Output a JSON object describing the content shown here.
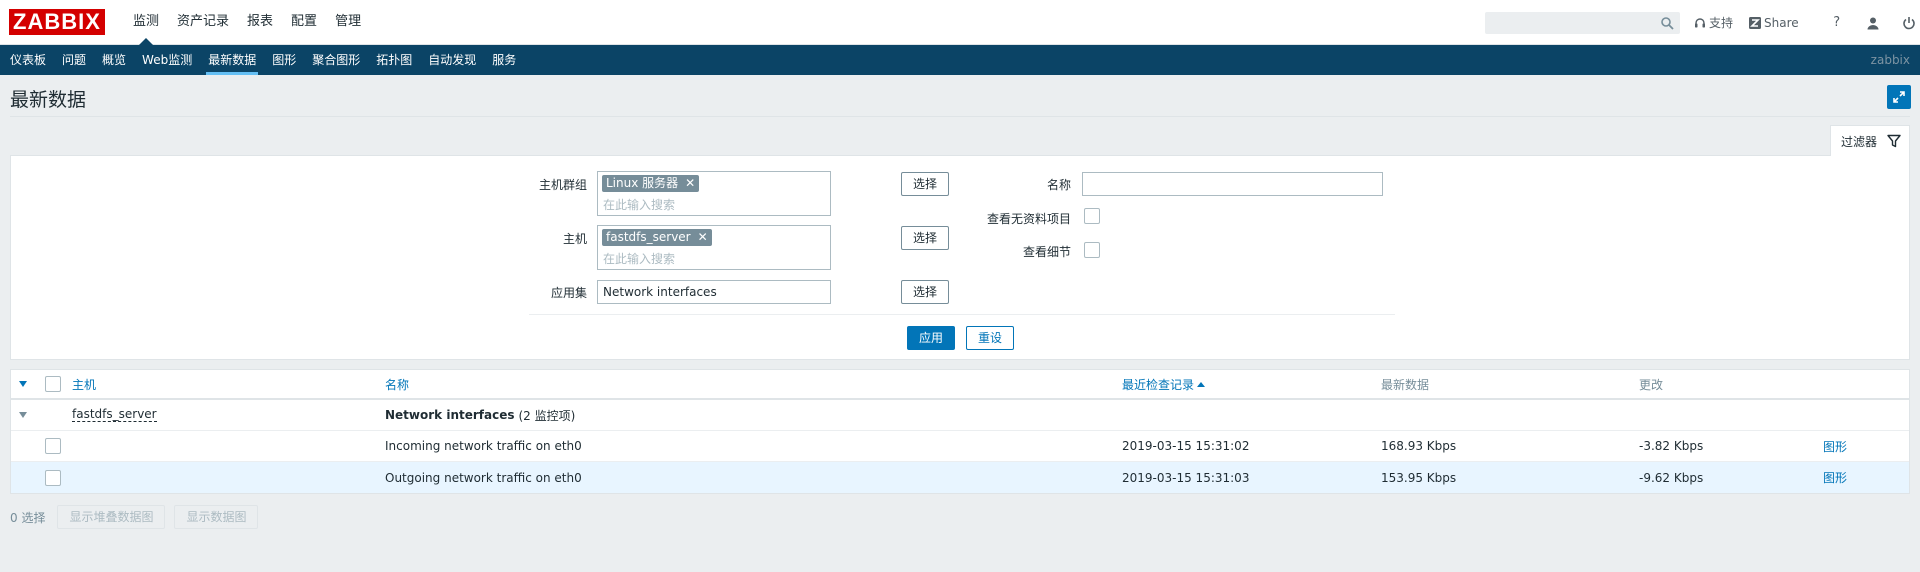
{
  "brand": {
    "logo_text": "ZABBIX",
    "logo_color": "#d40000"
  },
  "main_nav": [
    {
      "label": "监测",
      "active": true
    },
    {
      "label": "资产记录",
      "active": false
    },
    {
      "label": "报表",
      "active": false
    },
    {
      "label": "配置",
      "active": false
    },
    {
      "label": "管理",
      "active": false
    }
  ],
  "top_right": {
    "search_value": "",
    "support_label": "支持",
    "share_label": "Share",
    "help_label": "?"
  },
  "sub_nav": [
    {
      "label": "仪表板",
      "active": false
    },
    {
      "label": "问题",
      "active": false
    },
    {
      "label": "概览",
      "active": false
    },
    {
      "label": "Web监测",
      "active": false
    },
    {
      "label": "最新数据",
      "active": true
    },
    {
      "label": "图形",
      "active": false
    },
    {
      "label": "聚合图形",
      "active": false
    },
    {
      "label": "拓扑图",
      "active": false
    },
    {
      "label": "自动发现",
      "active": false
    },
    {
      "label": "服务",
      "active": false
    }
  ],
  "sub_nav_user": "zabbix",
  "page": {
    "title": "最新数据"
  },
  "filter": {
    "tab_label": "过滤器",
    "host_group_label": "主机群组",
    "host_group_tag": "Linux 服务器",
    "host_group_placeholder": "在此输入搜索",
    "host_label": "主机",
    "host_tag": "fastdfs_server",
    "host_placeholder": "在此输入搜索",
    "app_label": "应用集",
    "app_value": "Network interfaces",
    "select_label": "选择",
    "name_label": "名称",
    "name_value": "",
    "show_no_data_label": "查看无资料项目",
    "show_details_label": "查看细节",
    "apply_label": "应用",
    "reset_label": "重设"
  },
  "table": {
    "headers": {
      "host": "主机",
      "name": "名称",
      "last_check": "最近检查记录",
      "last_value": "最新数据",
      "change": "更改"
    },
    "group": {
      "host": "fastdfs_server",
      "app_name": "Network interfaces",
      "app_count": "(2 监控项)"
    },
    "rows": [
      {
        "name": "Incoming network traffic on eth0",
        "last_check": "2019-03-15 15:31:02",
        "last_value": "168.93 Kbps",
        "change": "-3.82 Kbps",
        "graph": "图形"
      },
      {
        "name": "Outgoing network traffic on eth0",
        "last_check": "2019-03-15 15:31:03",
        "last_value": "153.95 Kbps",
        "change": "-9.62 Kbps",
        "graph": "图形"
      }
    ]
  },
  "footer": {
    "selected_count": "0 选择",
    "show_stacked_label": "显示堆叠数据图",
    "show_graph_label": "显示数据图"
  }
}
